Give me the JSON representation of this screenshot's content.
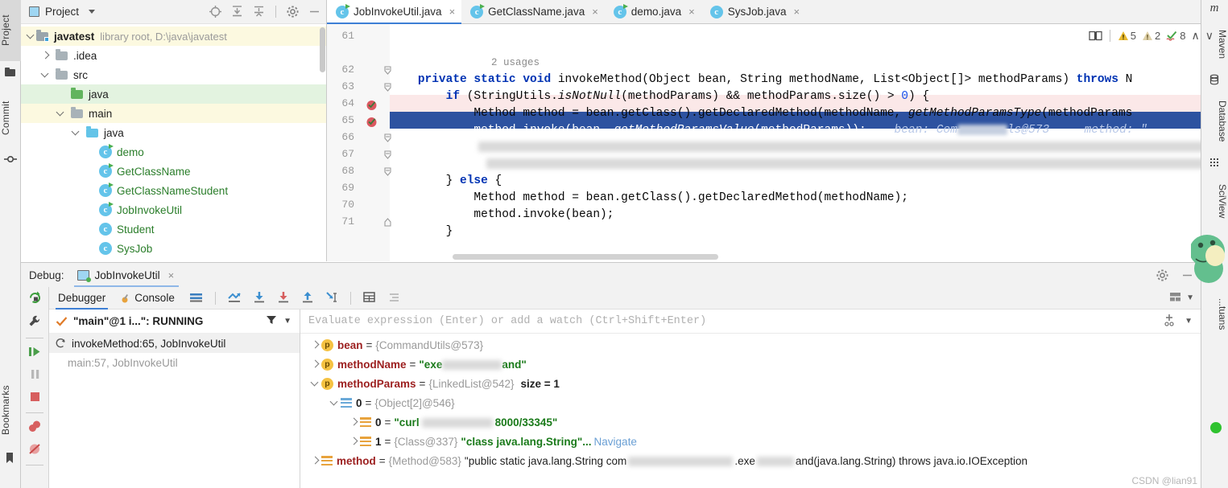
{
  "left_strip": {
    "tabs": [
      {
        "label": "Project",
        "icon": "project-icon",
        "active": true
      },
      {
        "label": "Commit",
        "icon": "commit-icon",
        "active": false
      },
      {
        "label": "Bookmarks",
        "icon": "bookmark-icon",
        "active": false
      }
    ]
  },
  "project_panel": {
    "title": "Project",
    "toolbar_icons": [
      "locate-icon",
      "expand-all-icon",
      "collapse-all-icon",
      "settings-gear-icon",
      "hide-icon"
    ],
    "tree": [
      {
        "indent": 0,
        "arrow": "down",
        "icon": "module-folder-icon",
        "label": "javatest",
        "bold": true,
        "sub": "library root,  D:\\java\\javatest",
        "highlight": "yellow"
      },
      {
        "indent": 1,
        "arrow": "right",
        "icon": "folder-icon",
        "label": ".idea",
        "bold": false,
        "sub": "",
        "highlight": "none"
      },
      {
        "indent": 1,
        "arrow": "down",
        "icon": "folder-icon",
        "label": "src",
        "bold": false,
        "sub": "",
        "highlight": "none"
      },
      {
        "indent": 2,
        "arrow": "none",
        "icon": "source-folder-icon",
        "label": "java",
        "bold": false,
        "sub": "",
        "highlight": "green"
      },
      {
        "indent": 2,
        "arrow": "down",
        "icon": "folder-icon",
        "label": "main",
        "bold": false,
        "sub": "",
        "highlight": "yellow"
      },
      {
        "indent": 3,
        "arrow": "down",
        "icon": "package-folder-icon",
        "label": "java",
        "bold": false,
        "sub": "",
        "highlight": "none"
      },
      {
        "indent": 4,
        "arrow": "none",
        "icon": "java-runnable-class-icon",
        "label": "demo",
        "bold": false,
        "sub": "",
        "highlight": "none"
      },
      {
        "indent": 4,
        "arrow": "none",
        "icon": "java-runnable-class-icon",
        "label": "GetClassName",
        "bold": false,
        "sub": "",
        "highlight": "none"
      },
      {
        "indent": 4,
        "arrow": "none",
        "icon": "java-runnable-class-icon",
        "label": "GetClassNameStudent",
        "bold": false,
        "sub": "",
        "highlight": "none"
      },
      {
        "indent": 4,
        "arrow": "none",
        "icon": "java-runnable-class-icon",
        "label": "JobInvokeUtil",
        "bold": false,
        "sub": "",
        "highlight": "none"
      },
      {
        "indent": 4,
        "arrow": "none",
        "icon": "java-class-icon",
        "label": "Student",
        "bold": false,
        "sub": "",
        "highlight": "none"
      },
      {
        "indent": 4,
        "arrow": "none",
        "icon": "java-class-icon",
        "label": "SysJob",
        "bold": false,
        "sub": "",
        "highlight": "none"
      }
    ]
  },
  "editor": {
    "tabs": [
      {
        "label": "JobInvokeUtil.java",
        "icon": "java-runnable-class-icon",
        "active": true,
        "close": "×"
      },
      {
        "label": "GetClassName.java",
        "icon": "java-runnable-class-icon",
        "active": false,
        "close": "×"
      },
      {
        "label": "demo.java",
        "icon": "java-runnable-class-icon",
        "active": false,
        "close": "×"
      },
      {
        "label": "SysJob.java",
        "icon": "java-class-icon",
        "active": false,
        "close": "×"
      }
    ],
    "overflow_menu": "⋮",
    "status": {
      "book_icon": "reader-mode-icon",
      "warnings_label": "5",
      "weak_warnings_label": "2",
      "typos_label": "8",
      "up_arrow": "∧",
      "down_arrow": "∨"
    },
    "usages_hint": "2 usages",
    "lines": [
      {
        "no": "61",
        "text": ""
      },
      {
        "no": "62",
        "fold": true,
        "text": "    private static void invokeMethod(Object bean, String methodName, List<Object[]> methodParams) throws N"
      },
      {
        "no": "63",
        "fold": true,
        "text": "        if (StringUtils.isNotNull(methodParams) && methodParams.size() > 0) {"
      },
      {
        "no": "64",
        "breakpoint": true,
        "highlight": "pink",
        "text": "            Method method = bean.getClass().getDeclaredMethod(methodName, getMethodParamsType(methodParams"
      },
      {
        "no": "65",
        "breakpoint": true,
        "highlight": "selected",
        "text": "            method.invoke(bean, getMethodParamsValue(methodParams));",
        "hint": "bean: Com▓▓▓▓ls@573     method: \""
      },
      {
        "no": "66",
        "fold": true,
        "text": "",
        "blurred": true
      },
      {
        "no": "67",
        "fold": true,
        "text": "",
        "blurred": true
      },
      {
        "no": "68",
        "fold": true,
        "text": "        } else {"
      },
      {
        "no": "69",
        "text": "            Method method = bean.getClass().getDeclaredMethod(methodName);"
      },
      {
        "no": "70",
        "text": "            method.invoke(bean);"
      },
      {
        "no": "71",
        "fold": true,
        "text": "        }"
      }
    ]
  },
  "debug": {
    "label": "Debug:",
    "session_tab": "JobInvokeUtil",
    "session_close": "×",
    "settings_icon": "gear-icon",
    "hide_icon": "minimize-icon",
    "left_actions": [
      "rerun-icon",
      "debug-settings-wrench-icon",
      "resume-program-icon",
      "pause-program-icon",
      "stop-icon",
      "view-breakpoints-icon",
      "mute-breakpoints-icon"
    ],
    "tabs": [
      {
        "label": "Debugger",
        "active": true
      },
      {
        "label": "Console",
        "active": false,
        "icon": "console-icon"
      }
    ],
    "toolbar_icons": [
      "layout-icon",
      "show-execution-point-icon",
      "step-over-icon",
      "step-into-icon",
      "step-out-icon",
      "run-to-cursor-icon",
      "evaluate-table-icon",
      "settings-list-icon"
    ],
    "toolbar_right_icons": [
      "layout-settings-icon",
      "chevron-down-icon"
    ],
    "thread": {
      "status_icon": "checkmark-icon",
      "text": "\"main\"@1 i...\": RUNNING",
      "filter_icon": "filter-icon",
      "dropdown_icon": "chevron-down-icon"
    },
    "frames": [
      {
        "label": "invokeMethod:65, JobInvokeUtil",
        "icon": "frame-icon",
        "selected": true
      },
      {
        "label": "main:57, JobInvokeUtil",
        "icon": "",
        "selected": false
      }
    ],
    "evaluate": {
      "placeholder": "Evaluate expression (Enter) or add a watch (Ctrl+Shift+Enter)",
      "add_watch_icon": "add-watch-icon",
      "dropdown_icon": "chevron-down-icon"
    },
    "variables": [
      {
        "indent": 0,
        "arrow": "right",
        "icon": "param-icon",
        "name": "bean",
        "eq": "=",
        "type": "{CommandUtils@573}",
        "value": "",
        "size": "",
        "nav": ""
      },
      {
        "indent": 0,
        "arrow": "right",
        "icon": "param-icon",
        "name": "methodName",
        "eq": "=",
        "type": "",
        "value": "\"exe▓▓▓▓▓and\"",
        "size": "",
        "nav": ""
      },
      {
        "indent": 0,
        "arrow": "down",
        "icon": "param-icon",
        "name": "methodParams",
        "eq": "=",
        "type": "{LinkedList@542}",
        "value": "",
        "size": "size = 1",
        "nav": ""
      },
      {
        "indent": 1,
        "arrow": "down",
        "icon": "array-index-icon",
        "name": "0",
        "eq": "=",
        "type": "{Object[2]@546}",
        "value": "",
        "size": "",
        "nav": ""
      },
      {
        "indent": 2,
        "arrow": "right",
        "icon": "list-item-icon",
        "name": "0",
        "eq": "=",
        "type": "",
        "value": "\"curl ▓▓▓▓▓ 8000/33345\"",
        "size": "",
        "nav": ""
      },
      {
        "indent": 2,
        "arrow": "right",
        "icon": "list-item-icon",
        "name": "1",
        "eq": "=",
        "type": "{Class@337}",
        "value": "\"class java.lang.String\"...",
        "size": "",
        "nav": "Navigate"
      },
      {
        "indent": 0,
        "arrow": "right",
        "icon": "list-item-icon",
        "name": "method",
        "eq": "=",
        "type": "{Method@583}",
        "value": "\"public static java.lang.String com▓▓▓▓.exe▓▓▓and(java.lang.String) throws java.io.IOException",
        "size": "",
        "nav": ""
      }
    ]
  },
  "right_strip": {
    "tabs": [
      {
        "label": "Maven",
        "icon": "maven-icon"
      },
      {
        "label": "Database",
        "icon": "database-icon"
      },
      {
        "label": "SciView",
        "icon": "sciview-icon"
      },
      {
        "label": "...tuans",
        "icon": "mascot-icon"
      }
    ]
  },
  "watermark": "CSDN @lian91",
  "colors": {
    "accent_blue": "#3e7fd5",
    "selection_blue": "#2d52a0",
    "keyword_blue": "#0033b3",
    "string_green": "#1a7a1a",
    "warning_yellow": "#e8a33d",
    "breakpoint_red": "#db5860",
    "panel_gray": "#f2f2f2"
  }
}
